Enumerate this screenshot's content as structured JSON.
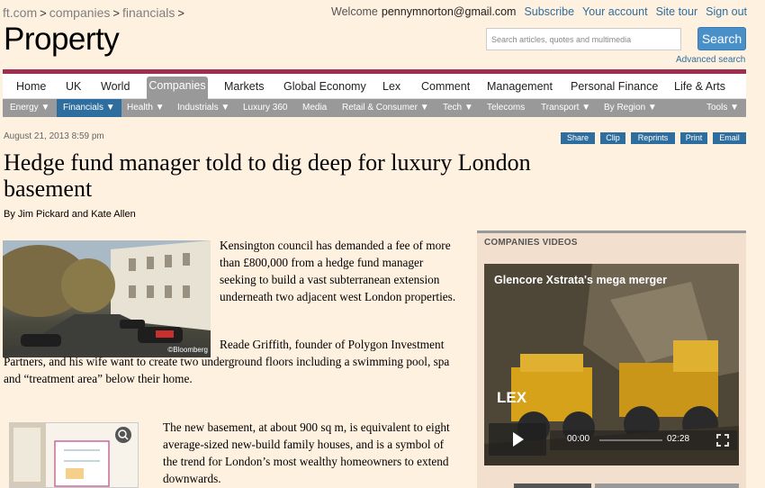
{
  "breadcrumb": {
    "site": "ft.com",
    "level1": "companies",
    "level2": "financials",
    "sep": ">"
  },
  "user_bar": {
    "welcome": "Welcome",
    "email": "pennymnorton@gmail.com",
    "subscribe": "Subscribe",
    "account": "Your account",
    "tour": "Site tour",
    "signout": "Sign out"
  },
  "header": {
    "section_title": "Property"
  },
  "search": {
    "placeholder": "Search articles, quotes and multimedia",
    "button": "Search",
    "advanced": "Advanced search"
  },
  "nav": {
    "items": [
      "Home",
      "UK",
      "World",
      "Companies",
      "Markets",
      "Global Economy",
      "Lex",
      "Comment",
      "Management",
      "Personal Finance",
      "Life & Arts"
    ],
    "active": "Companies"
  },
  "subnav": {
    "items": [
      "Energy ▼",
      "Financials ▼",
      "Health ▼",
      "Industrials ▼",
      "Luxury 360",
      "Media",
      "Retail & Consumer ▼",
      "Tech ▼",
      "Telecoms",
      "Transport ▼",
      "By Region ▼",
      "Tools ▼"
    ],
    "active": "Financials ▼"
  },
  "article": {
    "date": "August 21, 2013 8:59 pm",
    "tools": [
      "Share",
      "Clip",
      "Reprints",
      "Print",
      "Email"
    ],
    "headline": "Hedge fund manager told to dig deep for luxury London basement",
    "byline": "By Jim Pickard and Kate Allen",
    "image_credit": "©Bloomberg",
    "paragraphs": [
      "Kensington council has demanded a fee of more than £800,000 from a hedge fund manager seeking to build a vast subterranean extension underneath two adjacent west London properties.",
      "Reade Griffith, founder of Polygon Investment Partners, and his wife want to create two underground floors including a swimming pool, spa and “treatment area” below their home.",
      "The new basement, at about 900 sq m, is equivalent to eight average-sized new-build family houses, and is a symbol of the trend for London’s most wealthy homeowners to extend downwards."
    ]
  },
  "sidebar": {
    "title": "COMPANIES VIDEOS",
    "video_title": "Glencore Xstrata's mega merger",
    "video_overlay": "LEX",
    "time_current": "00:00",
    "time_total": "02:28",
    "progress": 0
  },
  "colors": {
    "background": "#fff1e0",
    "accent": "#9e2f50",
    "link": "#2e6e9e",
    "nav_gray": "#999999"
  },
  "icons": [
    "magnifier-icon",
    "play-icon",
    "fullscreen-icon"
  ]
}
